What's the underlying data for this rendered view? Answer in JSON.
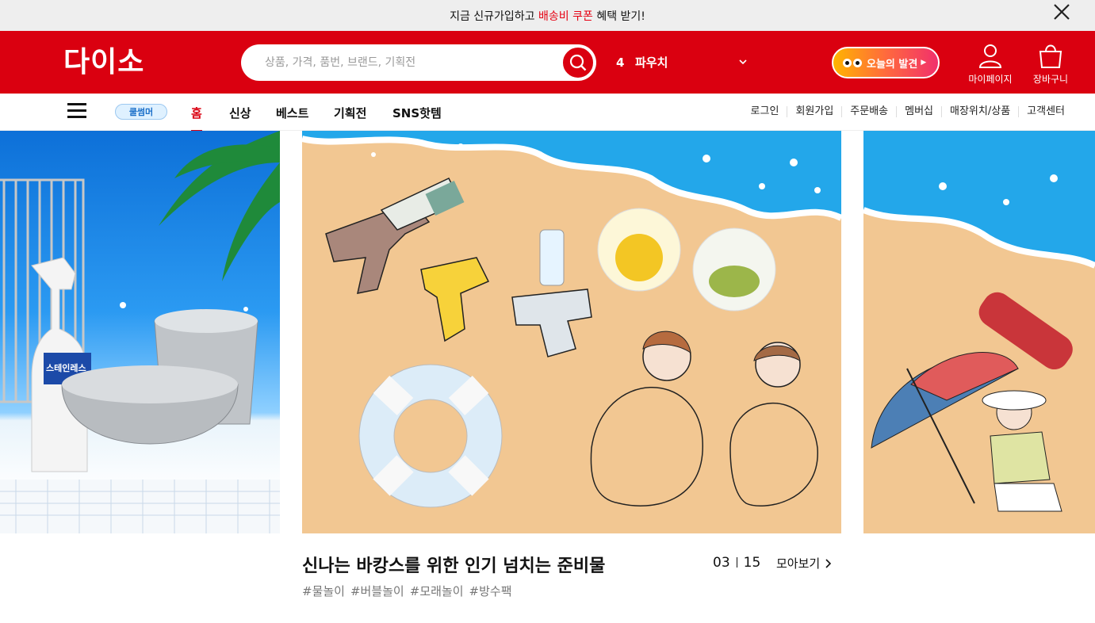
{
  "promo": {
    "prefix": "지금 신규가입하고 ",
    "highlight": "배송비 쿠폰",
    "suffix": " 혜택 받기!",
    "highlight_color": "#e60012"
  },
  "header": {
    "logo": "다이소",
    "brand_color": "#da0010",
    "search": {
      "placeholder": "상품, 가격, 품번, 브랜드, 기획전"
    },
    "ranking": {
      "number": "4",
      "term": "파우치"
    },
    "today_button": "오늘의 발견",
    "mypage_label": "마이페이지",
    "cart_label": "장바구니"
  },
  "nav": {
    "event_badge": "쿨썸머",
    "items": [
      "홈",
      "신상",
      "베스트",
      "기획전",
      "SNS핫템"
    ],
    "active_index": 0,
    "utility": [
      "로그인",
      "회원가입",
      "주문배송",
      "멤버십",
      "매장위치/상품",
      "고객센터"
    ]
  },
  "banner": {
    "title": "신나는 바캉스를 위한 인기 넘치는 준비물",
    "tags": [
      "#물놀이",
      "#버블놀이",
      "#모래놀이",
      "#방수팩"
    ],
    "current": "03",
    "total": "15",
    "more_label": "모아보기",
    "left_product_label": "스테인레스\n클리너"
  },
  "icons": [
    "close-icon",
    "search-icon",
    "chevron-down-icon",
    "user-icon",
    "bag-icon",
    "hamburger-icon",
    "chevron-right-icon"
  ]
}
